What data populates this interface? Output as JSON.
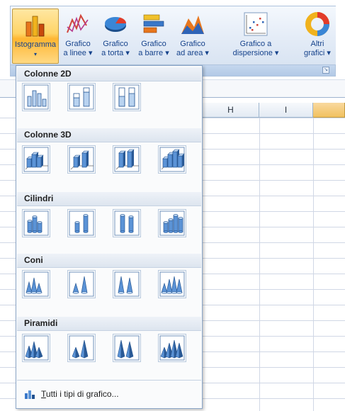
{
  "ribbon": {
    "buttons": [
      {
        "line1": "Istogramma",
        "line2": "▾",
        "icon": "column-chart-icon"
      },
      {
        "line1": "Grafico",
        "line2": "a linee ▾",
        "icon": "line-chart-icon"
      },
      {
        "line1": "Grafico",
        "line2": "a torta ▾",
        "icon": "pie-chart-icon"
      },
      {
        "line1": "Grafico",
        "line2": "a barre ▾",
        "icon": "bar-chart-icon"
      },
      {
        "line1": "Grafico",
        "line2": "ad area ▾",
        "icon": "area-chart-icon"
      },
      {
        "line1": "Grafico a",
        "line2": "dispersione ▾",
        "icon": "scatter-chart-icon"
      },
      {
        "line1": "Altri",
        "line2": "grafici ▾",
        "icon": "doughnut-chart-icon"
      }
    ],
    "active_button": "Istogramma"
  },
  "sheet": {
    "columns": [
      "H",
      "I"
    ]
  },
  "gallery": {
    "sections": [
      {
        "title": "Colonne 2D",
        "count": 3
      },
      {
        "title": "Colonne 3D",
        "count": 4
      },
      {
        "title": "Cilindri",
        "count": 4
      },
      {
        "title": "Coni",
        "count": 4
      },
      {
        "title": "Piramidi",
        "count": 4
      }
    ],
    "footer": {
      "label_underlined": "T",
      "label_rest": "utti i tipi di grafico..."
    }
  },
  "colors": {
    "ribbon_text": "#15428b",
    "active_highlight": "#ffd466",
    "selected_column": "#f1c15f"
  }
}
